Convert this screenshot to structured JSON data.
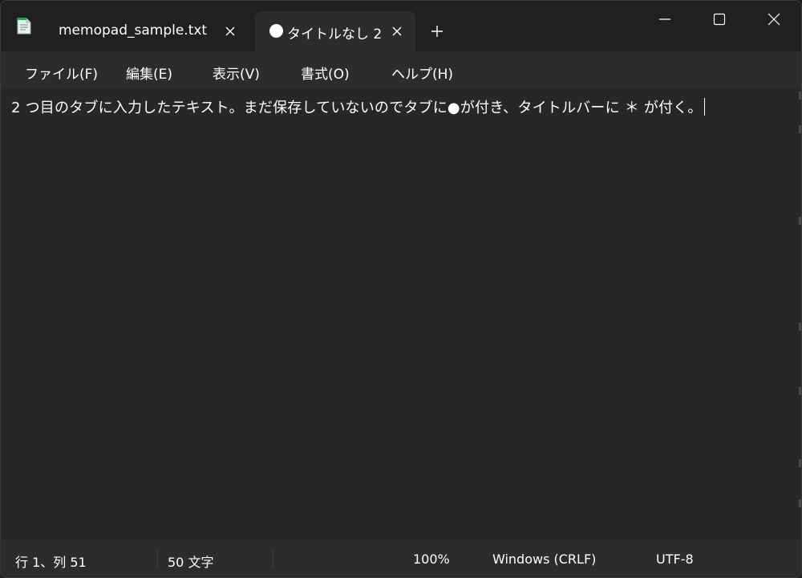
{
  "titlebar": {
    "tabs": [
      {
        "label": "memopad_sample.txt",
        "active": false,
        "unsaved": false
      },
      {
        "label": "タイトルなし 2",
        "active": true,
        "unsaved": true
      }
    ],
    "new_tab_glyph": "+",
    "close_glyph": "✕",
    "icons": {
      "app": "notepad-icon",
      "unsaved": "unsaved-dot-icon",
      "minimize": "minimize-icon",
      "maximize": "maximize-icon",
      "close": "close-icon"
    }
  },
  "menu": {
    "items": [
      "ファイル(F)",
      "編集(E)",
      "表示(V)",
      "書式(O)",
      "ヘルプ(H)"
    ]
  },
  "editor": {
    "text": "2 つ目のタブに入力したテキスト。まだ保存していないのでタブに●が付き、タイトルバーに ＊ が付く。"
  },
  "status": {
    "position": "行 1、列 51",
    "char_count": "50 文字",
    "zoom": "100%",
    "line_ending": "Windows (CRLF)",
    "encoding": "UTF-8"
  },
  "colors": {
    "titlebar_bg": "#202020",
    "menubar_bg": "#2c2c2c",
    "editor_bg": "#272727",
    "text": "#ffffff"
  }
}
